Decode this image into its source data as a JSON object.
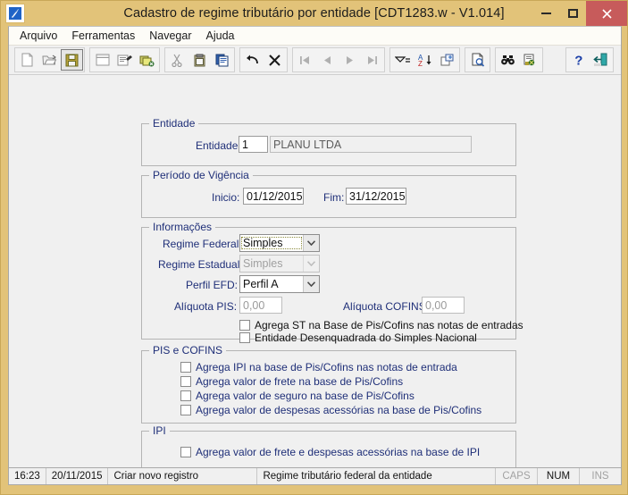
{
  "window": {
    "title": "Cadastro de regime tributário por entidade [CDT1283.w - V1.014]",
    "app_icon": "app-logo-icon",
    "minimize_label": "–",
    "maximize_label": "□",
    "close_label": "✕",
    "accent_titlebar": "#e2c379",
    "accent_close": "#c75b5b",
    "label_color": "#1f2f78"
  },
  "menu": {
    "items": [
      {
        "label": "Arquivo",
        "name": "menu-arquivo"
      },
      {
        "label": "Ferramentas",
        "name": "menu-ferramentas"
      },
      {
        "label": "Navegar",
        "name": "menu-navegar"
      },
      {
        "label": "Ajuda",
        "name": "menu-ajuda"
      }
    ]
  },
  "toolbar": {
    "groups": [
      {
        "buttons": [
          {
            "icon": "new-document-icon",
            "pressed": false
          },
          {
            "icon": "open-folder-icon",
            "pressed": false
          },
          {
            "icon": "save-disk-icon",
            "pressed": true
          }
        ]
      },
      {
        "buttons": [
          {
            "icon": "new-window-icon",
            "pressed": false
          },
          {
            "icon": "edit-properties-icon",
            "pressed": false
          },
          {
            "icon": "delete-records-icon",
            "pressed": false
          }
        ]
      },
      {
        "buttons": [
          {
            "icon": "cut-scissors-icon",
            "pressed": false
          },
          {
            "icon": "copy-icon",
            "pressed": false
          },
          {
            "icon": "paste-icon",
            "pressed": false
          }
        ]
      },
      {
        "buttons": [
          {
            "icon": "undo-arrow-icon",
            "pressed": false
          },
          {
            "icon": "cancel-x-icon",
            "pressed": false
          }
        ]
      },
      {
        "buttons": [
          {
            "icon": "first-record-icon",
            "pressed": false
          },
          {
            "icon": "previous-record-icon",
            "pressed": false
          },
          {
            "icon": "next-record-icon",
            "pressed": false
          },
          {
            "icon": "last-record-icon",
            "pressed": false
          }
        ]
      },
      {
        "buttons": [
          {
            "icon": "filter-icon",
            "pressed": false
          },
          {
            "icon": "sort-az-icon",
            "pressed": false
          },
          {
            "icon": "column-settings-icon",
            "pressed": false
          }
        ]
      },
      {
        "buttons": [
          {
            "icon": "print-preview-icon",
            "pressed": false
          }
        ]
      },
      {
        "buttons": [
          {
            "icon": "binoculars-search-icon",
            "pressed": false
          },
          {
            "icon": "advanced-search-icon",
            "pressed": false
          }
        ]
      },
      {
        "buttons": [
          {
            "icon": "help-question-icon",
            "pressed": false
          },
          {
            "icon": "exit-door-icon",
            "pressed": false
          }
        ]
      }
    ]
  },
  "form": {
    "entidade_group": {
      "legend": "Entidade",
      "entidade_label": "Entidade:",
      "entidade_code": "1",
      "entidade_name": "PLANU LTDA"
    },
    "vigencia_group": {
      "legend": "Período de Vigência",
      "inicio_label": "Inicio:",
      "inicio_value": "01/12/2015",
      "fim_label": "Fim:",
      "fim_value": "31/12/2015"
    },
    "informacoes_group": {
      "legend": "Informações",
      "regime_federal_label": "Regime Federal:",
      "regime_federal_value": "Simples",
      "regime_estadual_label": "Regime Estadual:",
      "regime_estadual_value": "Simples",
      "perfil_efd_label": "Perfil EFD:",
      "perfil_efd_value": "Perfil A",
      "aliquota_pis_label": "Alíquota PIS:",
      "aliquota_pis_value": "0,00",
      "aliquota_cofins_label": "Alíquota COFINS:",
      "aliquota_cofins_value": "0,00",
      "checkboxes": [
        {
          "label": "Agrega ST na Base de Pis/Cofins nas notas de entradas",
          "checked": false
        },
        {
          "label": "Entidade Desenquadrada do Simples Nacional",
          "checked": false
        }
      ]
    },
    "pis_cofins_group": {
      "legend": "PIS e COFINS",
      "checkboxes": [
        {
          "label": "Agrega IPI na base de Pis/Cofins nas notas de entrada",
          "checked": false
        },
        {
          "label": "Agrega valor de frete na base de Pis/Cofins",
          "checked": false
        },
        {
          "label": "Agrega valor de seguro na base de Pis/Cofins",
          "checked": false
        },
        {
          "label": "Agrega valor de despesas acessórias na base de Pis/Cofins",
          "checked": false
        }
      ]
    },
    "ipi_group": {
      "legend": "IPI",
      "checkboxes": [
        {
          "label": "Agrega valor de frete e despesas acessórias na base de IPI",
          "checked": false
        }
      ]
    }
  },
  "statusbar": {
    "time": "16:23",
    "date": "20/11/2015",
    "action": "Criar novo registro",
    "hint": "Regime tributário federal da entidade",
    "caps": "CAPS",
    "num": "NUM",
    "ins": "INS"
  }
}
